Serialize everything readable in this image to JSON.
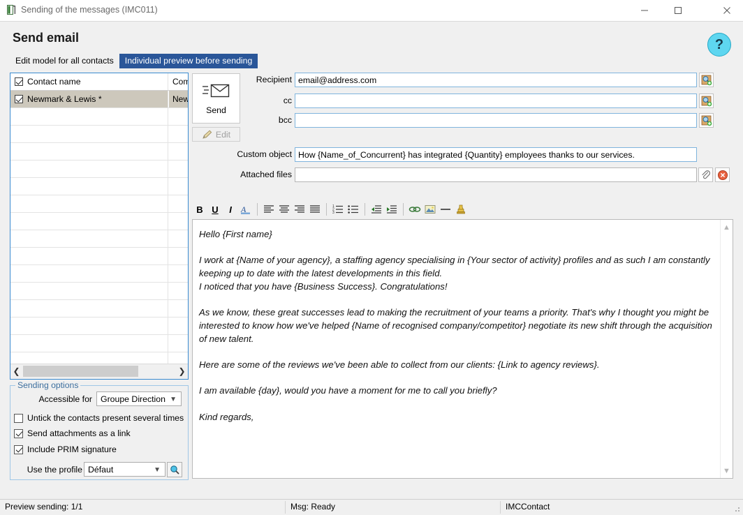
{
  "window": {
    "title": "Sending of the messages (IMC011)",
    "minimize_label": "minimize",
    "maximize_label": "maximize",
    "close_label": "close"
  },
  "header": {
    "page_title": "Send email",
    "help_label": "?"
  },
  "tabs": [
    {
      "label": "Edit model for all contacts",
      "active": false
    },
    {
      "label": "Individual preview before sending",
      "active": true
    }
  ],
  "contact_grid": {
    "columns": [
      "Contact name",
      "Com"
    ],
    "header_checkbox_checked": true,
    "rows": [
      {
        "checked": true,
        "name": "Newmark & Lewis *",
        "company": "New",
        "selected": true
      }
    ],
    "scroll_left_label": "❮",
    "scroll_right_label": "❯"
  },
  "actions": {
    "send_label": "Send",
    "edit_label": "Edit"
  },
  "form": {
    "recipient_label": "Recipient",
    "recipient_value": "email@address.com",
    "cc_label": "cc",
    "cc_value": "",
    "bcc_label": "bcc",
    "bcc_value": "",
    "custom_object_label": "Custom object",
    "custom_object_value": "How {Name_of_Concurrent} has integrated {Quantity} employees thanks to our services.",
    "attached_files_label": "Attached files",
    "attached_files_value": ""
  },
  "editor": {
    "toolbar": [
      {
        "name": "bold",
        "glyph": "B"
      },
      {
        "name": "underline",
        "glyph": "U"
      },
      {
        "name": "italic",
        "glyph": "I"
      },
      {
        "name": "font-color",
        "glyph": "A"
      },
      {
        "name": "align-left",
        "glyph": ""
      },
      {
        "name": "align-center",
        "glyph": ""
      },
      {
        "name": "align-right",
        "glyph": ""
      },
      {
        "name": "align-justify",
        "glyph": ""
      },
      {
        "name": "numbered-list",
        "glyph": ""
      },
      {
        "name": "bullet-list",
        "glyph": ""
      },
      {
        "name": "decrease-indent",
        "glyph": ""
      },
      {
        "name": "increase-indent",
        "glyph": ""
      },
      {
        "name": "insert-link",
        "glyph": ""
      },
      {
        "name": "insert-image",
        "glyph": ""
      },
      {
        "name": "horizontal-rule",
        "glyph": ""
      },
      {
        "name": "insert-signature",
        "glyph": ""
      }
    ],
    "body": "Hello {First name}\n\nI work at {Name of your agency}, a staffing agency specialising in {Your sector of activity} profiles and as such I am constantly keeping up to date with the latest developments in this field.\nI noticed that you have {Business Success}. Congratulations!\n\nAs we know, these great successes lead to making the recruitment of your teams a priority. That's why I thought you might be interested to know how we've helped {Name of recognised company/competitor} negotiate its new shift through the acquisition of new talent.\n\nHere are some of the reviews we've been able to collect from our clients: {Link to agency reviews}.\n\nI am available {day}, would you have a moment for me to call you briefly?\n\nKind regards,"
  },
  "sending_options": {
    "legend": "Sending options",
    "accessible_for_label": "Accessible for",
    "accessible_for_value": "Groupe Direction",
    "untick_duplicates_label": "Untick the contacts present several times",
    "untick_duplicates_checked": false,
    "attachments_link_label": "Send attachments as a link",
    "attachments_link_checked": true,
    "prim_signature_label": "Include PRIM signature",
    "prim_signature_checked": true,
    "profile_label": "Use the profile",
    "profile_value": "Défaut"
  },
  "status_bar": {
    "preview": "Preview sending: 1/1",
    "message": "Msg: Ready",
    "context": "IMCContact"
  },
  "colors": {
    "tab_active": "#2a5699",
    "panel_border": "#3a8ad0",
    "field_border": "#7fb4dd",
    "help_circle": "#5ed6f0",
    "selection": "#cdc8bc"
  }
}
